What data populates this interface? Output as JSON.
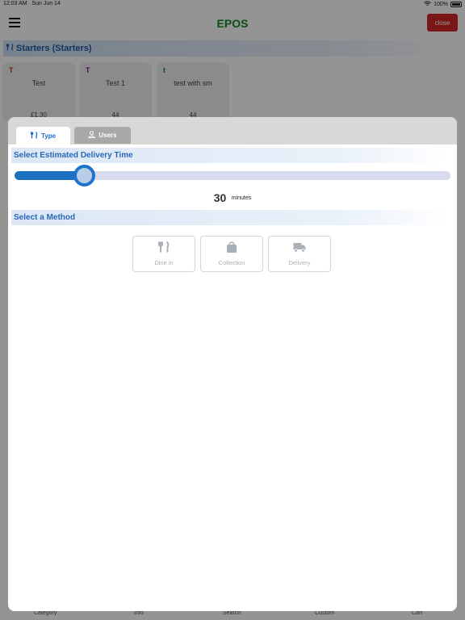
{
  "status_bar": {
    "time": "12:03 AM",
    "date": "Sun Jun 14",
    "battery": "100%"
  },
  "header": {
    "title": "EPOS",
    "close_label": "close"
  },
  "category": {
    "title": "Starters (Starters)"
  },
  "products": [
    {
      "letter": "T",
      "letter_color": "#c0392b",
      "name": "Test",
      "price": "£1.30"
    },
    {
      "letter": "T",
      "letter_color": "#8e1b8e",
      "name": "Test 1",
      "price": "44"
    },
    {
      "letter": "t",
      "letter_color": "#0b8a1f",
      "name": "test with sm",
      "price": "44"
    }
  ],
  "bottom_tabs": [
    "Category",
    "Info",
    "Search",
    "Custom",
    "Cart"
  ],
  "modal": {
    "tabs": {
      "type_label": "Type",
      "users_label": "Users"
    },
    "delivery_time": {
      "title": "Select Estimated Delivery Time",
      "value": "30",
      "unit": "minutes",
      "slider_fraction": 0.16
    },
    "method": {
      "title": "Select a Method",
      "options": [
        {
          "label": "Dine in",
          "icon": "fork-knife-icon"
        },
        {
          "label": "Collection",
          "icon": "bag-icon"
        },
        {
          "label": "Delivery",
          "icon": "truck-icon"
        }
      ]
    }
  },
  "colors": {
    "accent": "#1e74cc",
    "brand": "#0b8a1f",
    "danger": "#d32727"
  }
}
